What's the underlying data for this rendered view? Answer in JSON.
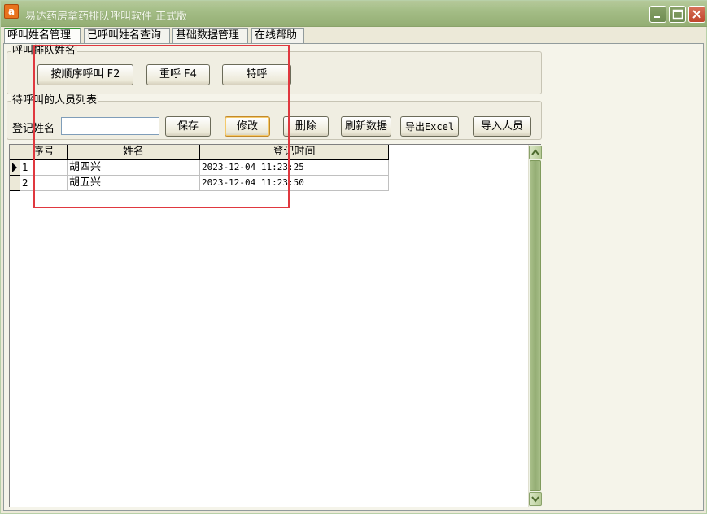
{
  "window": {
    "title": "易达药房拿药排队呼叫软件 正式版",
    "app_icon_glyph": "a"
  },
  "tabs": [
    {
      "label": "呼叫姓名管理",
      "active": true
    },
    {
      "label": "已呼叫姓名查询",
      "active": false
    },
    {
      "label": "基础数据管理",
      "active": false
    },
    {
      "label": "在线帮助",
      "active": false
    }
  ],
  "call_group": {
    "title": "呼叫排队姓名",
    "sequential_call_label": "按顺序呼叫 F2",
    "recall_label": "重呼 F4",
    "special_call_label": "特呼"
  },
  "waiting_group": {
    "title": "待呼叫的人员列表",
    "register_name_label": "登记姓名",
    "register_name_value": "",
    "save_label": "保存",
    "edit_label": "修改",
    "delete_label": "删除",
    "refresh_label": "刷新数据",
    "export_label": "导出Excel",
    "import_label": "导入人员"
  },
  "grid": {
    "columns": [
      "序号",
      "姓名",
      "登记时间"
    ],
    "rows": [
      {
        "index": "1",
        "name": "胡四兴",
        "time": "2023-12-04 11:23:25",
        "current": true
      },
      {
        "index": "2",
        "name": "胡五兴",
        "time": "2023-12-04 11:23:50",
        "current": false
      }
    ]
  },
  "colors": {
    "titlebar": "#a4bd86",
    "annotation_box": "#e0383f",
    "scrollbar": "#94ad74"
  }
}
